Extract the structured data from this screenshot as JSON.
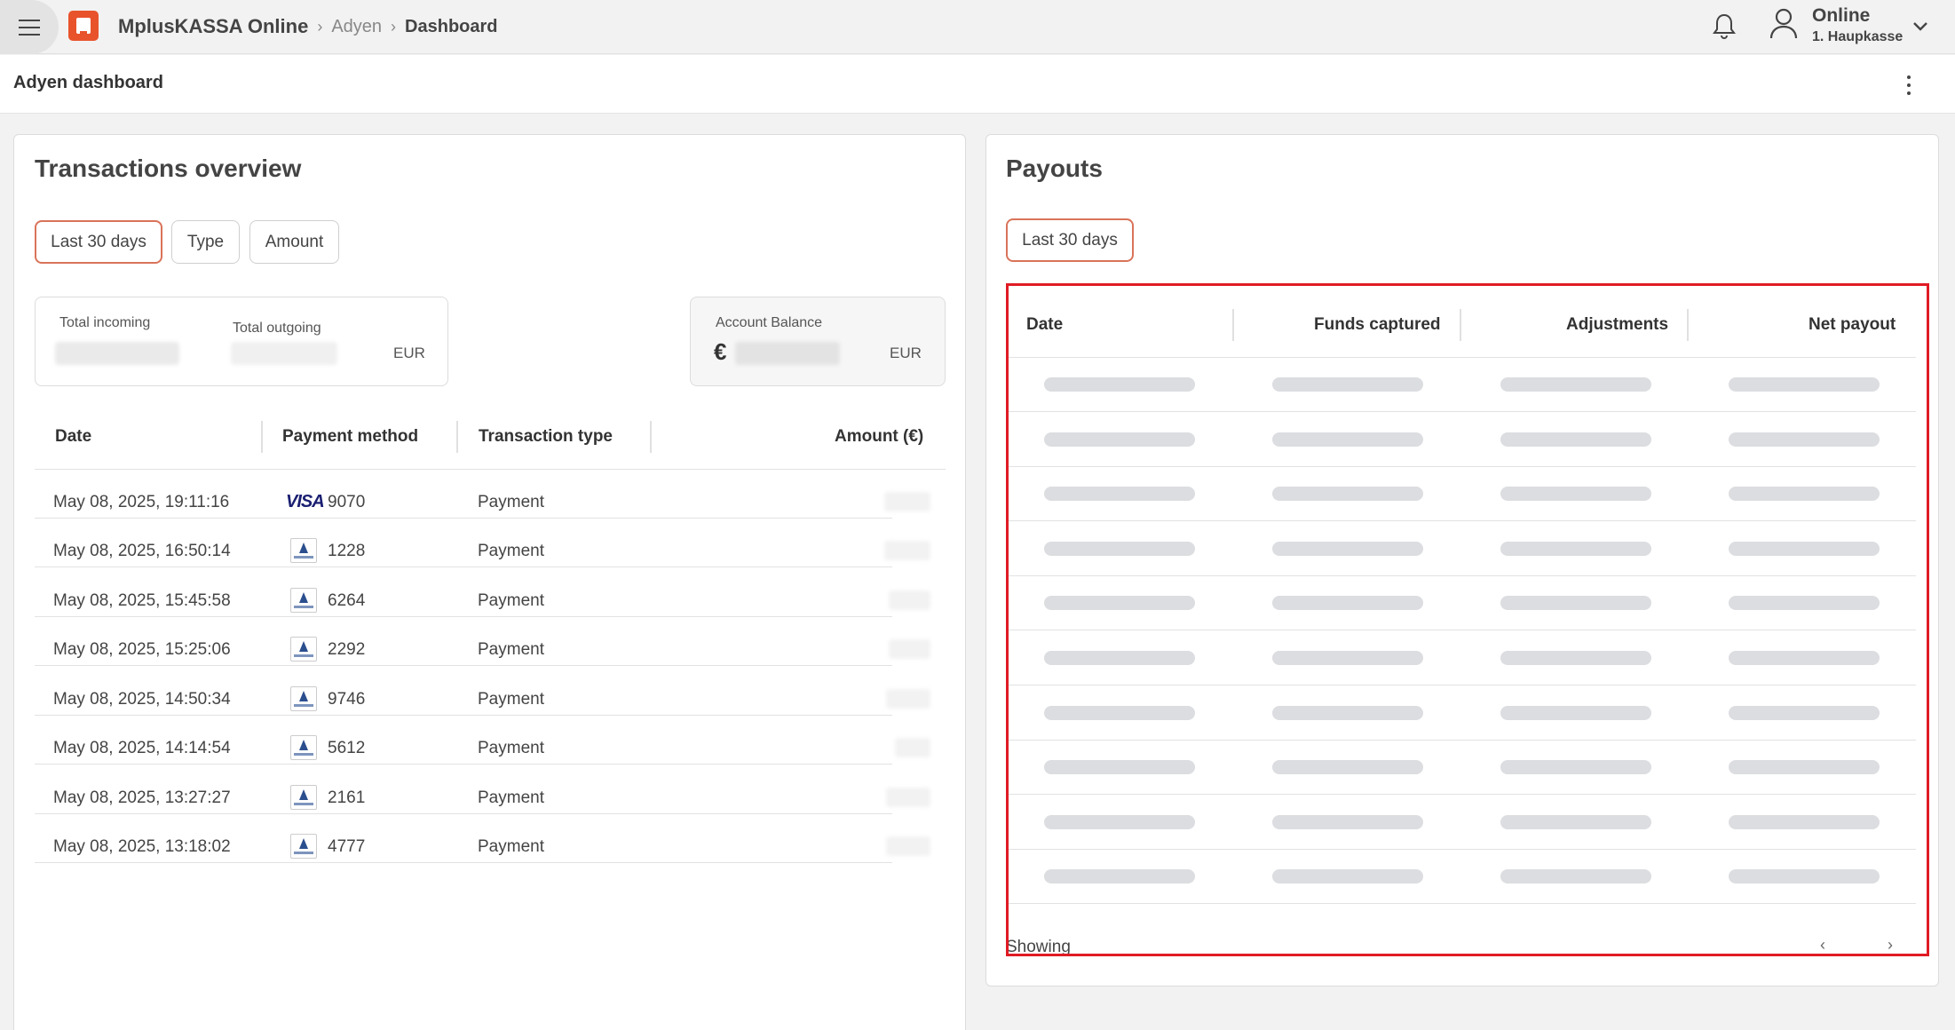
{
  "header": {
    "app_name": "MplusKASSA Online",
    "breadcrumb_mid": "Adyen",
    "breadcrumb_current": "Dashboard",
    "user_status": "Online",
    "register_name": "1. Haupkasse"
  },
  "subheader": {
    "title": "Adyen dashboard"
  },
  "transactions": {
    "title": "Transactions overview",
    "filters": [
      "Last 30 days",
      "Type",
      "Amount"
    ],
    "total_incoming_label": "Total incoming",
    "total_outgoing_label": "Total outgoing",
    "currency": "EUR",
    "account_balance_label": "Account Balance",
    "euro_symbol": "€",
    "columns": [
      "Date",
      "Payment method",
      "Transaction type",
      "Amount (€)"
    ],
    "rows": [
      {
        "date": "May 08, 2025, 19:11:16",
        "method": "visa",
        "method_label": "VISA",
        "card": "9070",
        "type": "Payment"
      },
      {
        "date": "May 08, 2025, 16:50:14",
        "method": "girocard",
        "card": "1228",
        "type": "Payment"
      },
      {
        "date": "May 08, 2025, 15:45:58",
        "method": "girocard",
        "card": "6264",
        "type": "Payment"
      },
      {
        "date": "May 08, 2025, 15:25:06",
        "method": "girocard",
        "card": "2292",
        "type": "Payment"
      },
      {
        "date": "May 08, 2025, 14:50:34",
        "method": "girocard",
        "card": "9746",
        "type": "Payment"
      },
      {
        "date": "May 08, 2025, 14:14:54",
        "method": "girocard",
        "card": "5612",
        "type": "Payment"
      },
      {
        "date": "May 08, 2025, 13:27:27",
        "method": "girocard",
        "card": "2161",
        "type": "Payment"
      },
      {
        "date": "May 08, 2025, 13:18:02",
        "method": "girocard",
        "card": "4777",
        "type": "Payment"
      }
    ]
  },
  "payouts": {
    "title": "Payouts",
    "filter": "Last 30 days",
    "columns": [
      "Date",
      "Funds captured",
      "Adjustments",
      "Net payout"
    ],
    "loading_rows": 10,
    "showing_label": "Showing",
    "prev_glyph": "‹",
    "next_glyph": "›"
  },
  "colors": {
    "brand": "#e8532c",
    "active_chip_border": "#d9735a",
    "highlight": "#e01b24",
    "skeleton": "#dcdde0"
  }
}
